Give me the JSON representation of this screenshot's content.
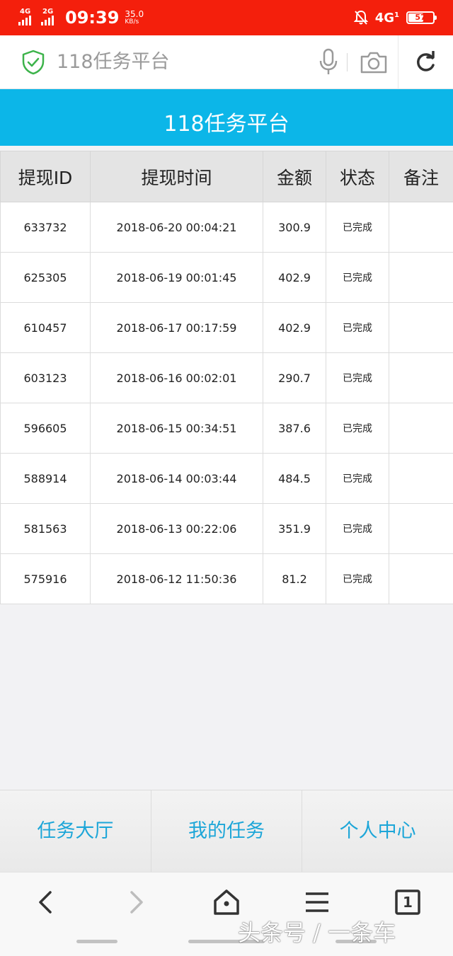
{
  "status_bar": {
    "net1": "4G",
    "net2": "2G",
    "time": "09:39",
    "speed_value": "35.0",
    "speed_unit": "KB/s",
    "net_right": "4G",
    "net_right_sub": "1",
    "battery": "57"
  },
  "address_bar": {
    "url_text": "118任务平台",
    "icons": [
      "shield-check-icon",
      "microphone-icon",
      "camera-icon",
      "reload-icon"
    ]
  },
  "page": {
    "title": "118任务平台"
  },
  "table": {
    "headers": [
      "提现ID",
      "提现时间",
      "金额",
      "状态",
      "备注"
    ],
    "rows": [
      {
        "id": "633732",
        "time": "2018-06-20 00:04:21",
        "amount": "300.9",
        "status": "已完成",
        "note": ""
      },
      {
        "id": "625305",
        "time": "2018-06-19 00:01:45",
        "amount": "402.9",
        "status": "已完成",
        "note": ""
      },
      {
        "id": "610457",
        "time": "2018-06-17 00:17:59",
        "amount": "402.9",
        "status": "已完成",
        "note": ""
      },
      {
        "id": "603123",
        "time": "2018-06-16 00:02:01",
        "amount": "290.7",
        "status": "已完成",
        "note": ""
      },
      {
        "id": "596605",
        "time": "2018-06-15 00:34:51",
        "amount": "387.6",
        "status": "已完成",
        "note": ""
      },
      {
        "id": "588914",
        "time": "2018-06-14 00:03:44",
        "amount": "484.5",
        "status": "已完成",
        "note": ""
      },
      {
        "id": "581563",
        "time": "2018-06-13 00:22:06",
        "amount": "351.9",
        "status": "已完成",
        "note": ""
      },
      {
        "id": "575916",
        "time": "2018-06-12 11:50:36",
        "amount": "81.2",
        "status": "已完成",
        "note": ""
      }
    ]
  },
  "app_nav": {
    "items": [
      "任务大厅",
      "我的任务",
      "个人中心"
    ]
  },
  "browser_bar": {
    "icons": [
      "back-icon",
      "forward-icon",
      "home-icon",
      "menu-icon",
      "tabs-icon"
    ],
    "tab_count": "1"
  },
  "watermark": "头条号 / 一条车",
  "colors": {
    "status_bar": "#f41f0c",
    "header": "#0cb6e8",
    "nav_text": "#1da6d8"
  }
}
